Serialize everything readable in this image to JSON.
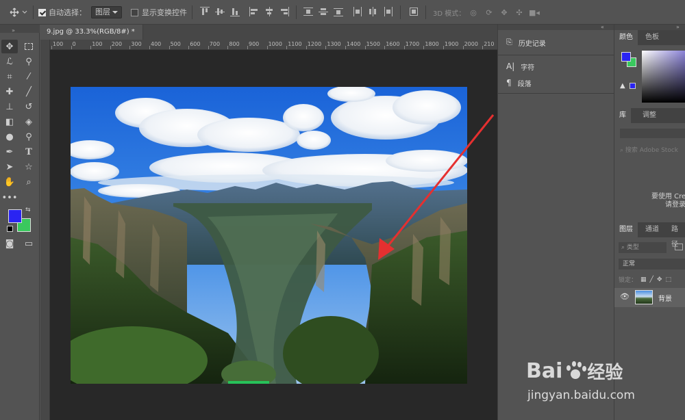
{
  "options_bar": {
    "auto_select_label": "自动选择：",
    "auto_select_value": "图层",
    "show_transform_label": "显示变换控件",
    "mode_3d_label": "3D 模式："
  },
  "document": {
    "tab_title": "9.jpg @ 33.3%(RGB/8#) *",
    "ruler_ticks": [
      "100",
      "0",
      "100",
      "200",
      "300",
      "400",
      "500",
      "600",
      "700",
      "800",
      "900",
      "1000",
      "1100",
      "1200",
      "1300",
      "1400",
      "1500",
      "1600",
      "1700",
      "1800",
      "1900",
      "2000",
      "210"
    ]
  },
  "mid_panel": {
    "history_label": "历史记录",
    "character_label": "字符",
    "paragraph_label": "段落"
  },
  "right_panel": {
    "tabs_top": [
      "颜色",
      "色板"
    ],
    "tabs_lib": [
      "库",
      "调整"
    ],
    "lib_search_placeholder": "搜索 Adobe Stock",
    "lib_message_line1": "要使用 Cre",
    "lib_message_line2": "请登录",
    "tabs_layers": [
      "图层",
      "通道",
      "路径"
    ],
    "layer_filter": "类型",
    "blend_mode": "正常",
    "lock_label": "锁定：",
    "layer_name": "背景"
  },
  "colors": {
    "foreground": "#2a24f2",
    "background": "#3ac85e",
    "arrow": "#e53030"
  },
  "watermark": {
    "brand": "Bai",
    "brand2": "经验",
    "url": "jingyan.baidu.com"
  }
}
